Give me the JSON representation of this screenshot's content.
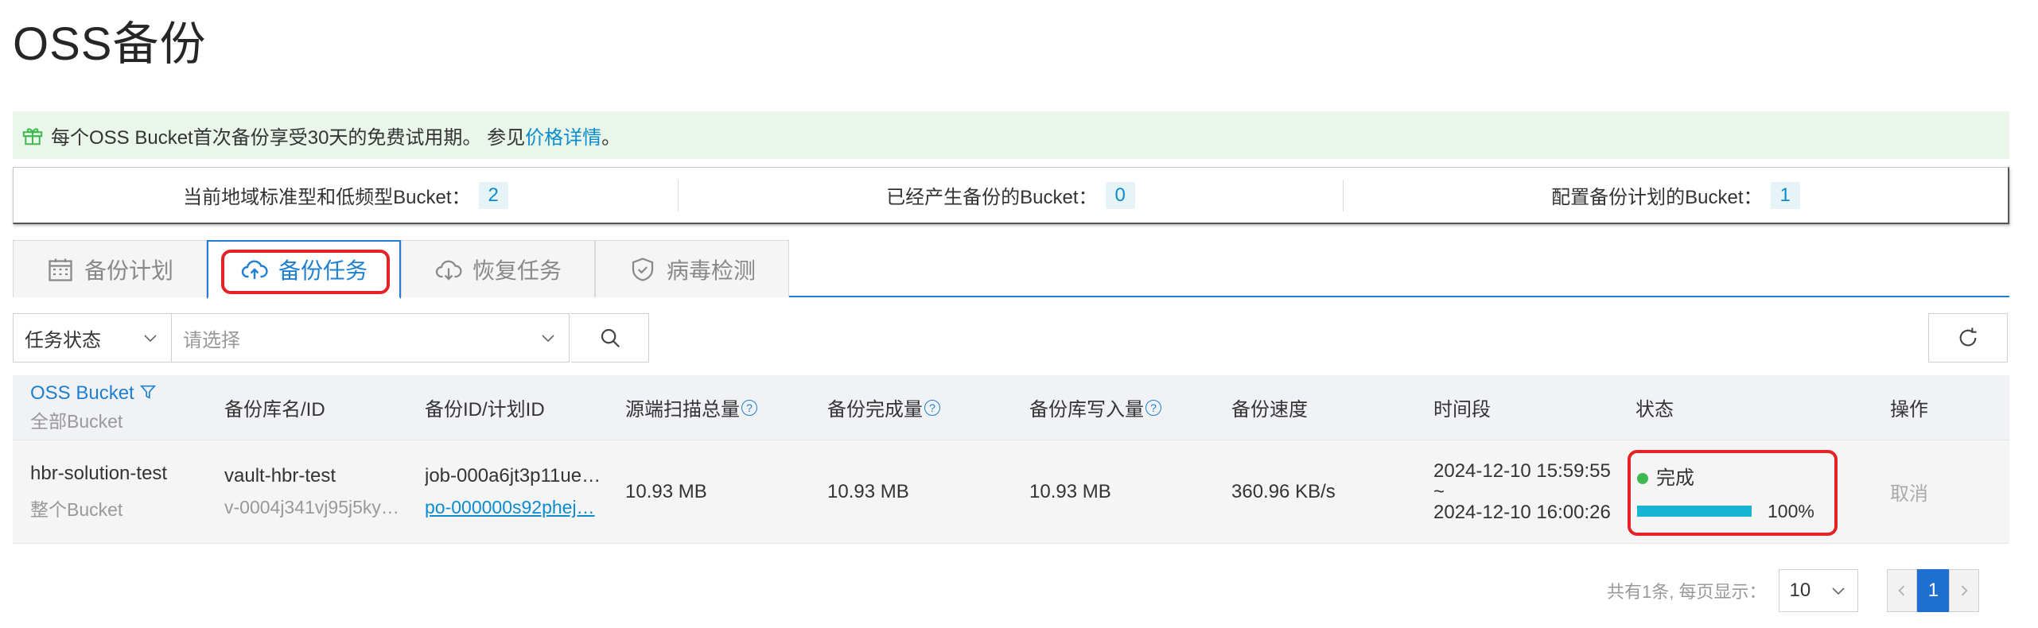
{
  "page": {
    "title": "OSS备份"
  },
  "notice": {
    "text": "每个OSS Bucket首次备份享受30天的免费试用期。 参见",
    "link": "价格详情",
    "suffix": "。"
  },
  "stats": [
    {
      "label": "当前地域标准型和低频型Bucket：",
      "count": "2"
    },
    {
      "label": "已经产生备份的Bucket：",
      "count": "0"
    },
    {
      "label": "配置备份计划的Bucket：",
      "count": "1"
    }
  ],
  "tabs": [
    {
      "label": "备份计划",
      "icon": "calendar-icon",
      "active": false
    },
    {
      "label": "备份任务",
      "icon": "cloud-upload-icon",
      "active": true
    },
    {
      "label": "恢复任务",
      "icon": "cloud-download-icon",
      "active": false
    },
    {
      "label": "病毒检测",
      "icon": "shield-check-icon",
      "active": false
    }
  ],
  "filters": {
    "status_select": "任务状态",
    "value_placeholder": "请选择"
  },
  "table": {
    "headers": {
      "bucket": "OSS Bucket",
      "bucket_sub": "全部Bucket",
      "vault": "备份库名/ID",
      "backup_id": "备份ID/计划ID",
      "scan_total": "源端扫描总量",
      "done": "备份完成量",
      "written": "备份库写入量",
      "speed": "备份速度",
      "time": "时间段",
      "status": "状态",
      "action": "操作"
    },
    "rows": [
      {
        "bucket": "hbr-solution-test",
        "bucket_scope": "整个Bucket",
        "vault_name": "vault-hbr-test",
        "vault_id": "v-0004j341vj95j5ky…",
        "job_id": "job-000a6jt3p11ue…",
        "plan_id": "po-000000s92phej…",
        "scan_total": "10.93 MB",
        "done": "10.93 MB",
        "written": "10.93 MB",
        "speed": "360.96 KB/s",
        "time_start": "2024-12-10 15:59:55",
        "time_sep": "~",
        "time_end": "2024-12-10 16:00:26",
        "status": "完成",
        "progress": "100%",
        "progress_value": 1.0,
        "action": "取消"
      }
    ]
  },
  "pager": {
    "summary": "共有1条, 每页显示：",
    "page_size": "10",
    "current_page": "1"
  },
  "colors": {
    "accent": "#1f7fd0",
    "link": "#0a8ccf",
    "success": "#3fb950",
    "progress": "#19b3d4",
    "highlight": "#e32426"
  }
}
